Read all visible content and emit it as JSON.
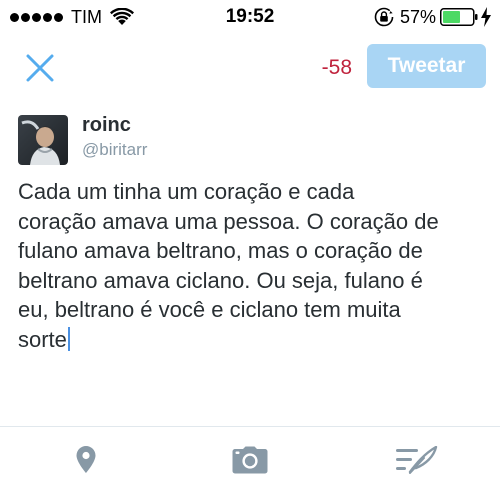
{
  "status_bar": {
    "carrier": "TIM",
    "time": "19:52",
    "battery_percent": "57%",
    "signal_bars": 5,
    "icons": [
      "wifi-icon",
      "orientation-lock-icon",
      "battery-icon",
      "charging-bolt-icon"
    ]
  },
  "compose": {
    "char_count": "-58",
    "tweet_button_label": "Tweetar",
    "close_icon": "close-icon"
  },
  "account": {
    "display_name": "roinc",
    "username": "@biritarr"
  },
  "tweet": {
    "text": "Cada um tinha um coração e cada\ncoração amava uma pessoa. O coração de\nfulano amava beltrano, mas o coração de\nbeltrano amava ciclano. Ou seja, fulano é\neu, beltrano é você e ciclano tem muita\nsorte"
  },
  "toolbar": {
    "icons": [
      "location-pin-icon",
      "camera-icon",
      "drafts-icon"
    ]
  },
  "colors": {
    "accent": "#55acee",
    "tweet_button_disabled": "#a9d5f4",
    "over_limit_red": "#c0233d",
    "battery_green": "#4cd964",
    "icon_gray": "#8899a6"
  }
}
